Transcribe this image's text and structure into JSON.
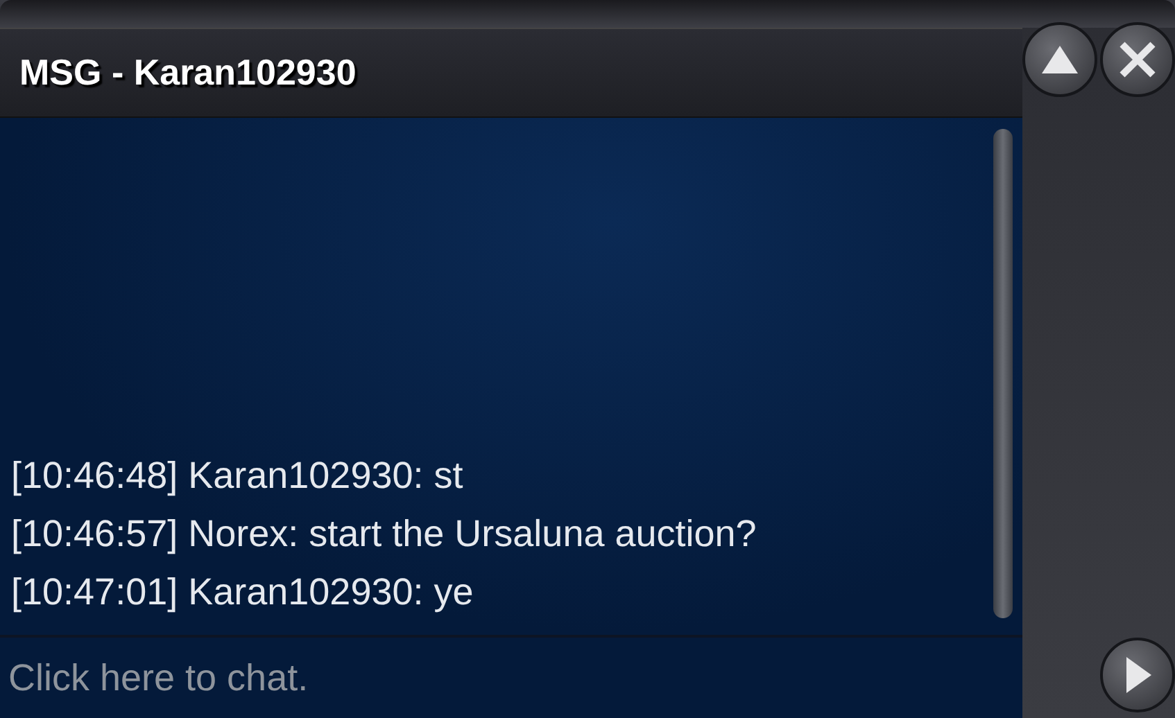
{
  "window": {
    "title": "MSG - Karan102930"
  },
  "messages": [
    {
      "text": "[10:46:48] Karan102930: st"
    },
    {
      "text": "[10:46:57] Norex: start the Ursaluna auction?"
    },
    {
      "text": "[10:47:01] Karan102930: ye"
    }
  ],
  "chat_input": {
    "placeholder": "Click here to chat."
  }
}
